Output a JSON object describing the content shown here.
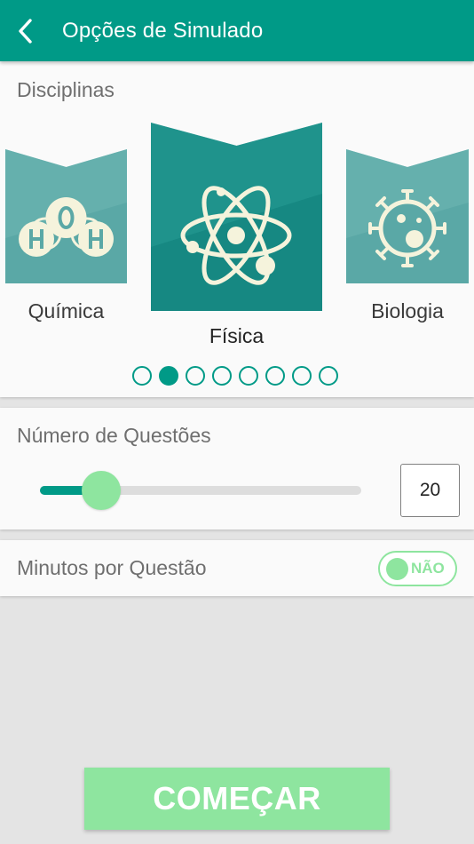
{
  "header": {
    "title": "Opções de Simulado",
    "back_icon": "chevron-left-icon",
    "color": "#009a87"
  },
  "disciplinas": {
    "label": "Disciplinas",
    "items": [
      {
        "label": "Química",
        "icon": "water-molecule-icon"
      },
      {
        "label": "Física",
        "icon": "atom-icon"
      },
      {
        "label": "Biologia",
        "icon": "virus-icon"
      }
    ],
    "selected_index": 1,
    "page_count": 8,
    "current_page": 2
  },
  "questoes": {
    "label": "Número de Questões",
    "value": "20",
    "slider_fraction": 0.19
  },
  "minutos": {
    "label": "Minutos por Questão",
    "toggle_text": "NÃO",
    "toggle_on": false
  },
  "start_button": {
    "label": "COMEÇAR",
    "color": "#8ee59f"
  }
}
